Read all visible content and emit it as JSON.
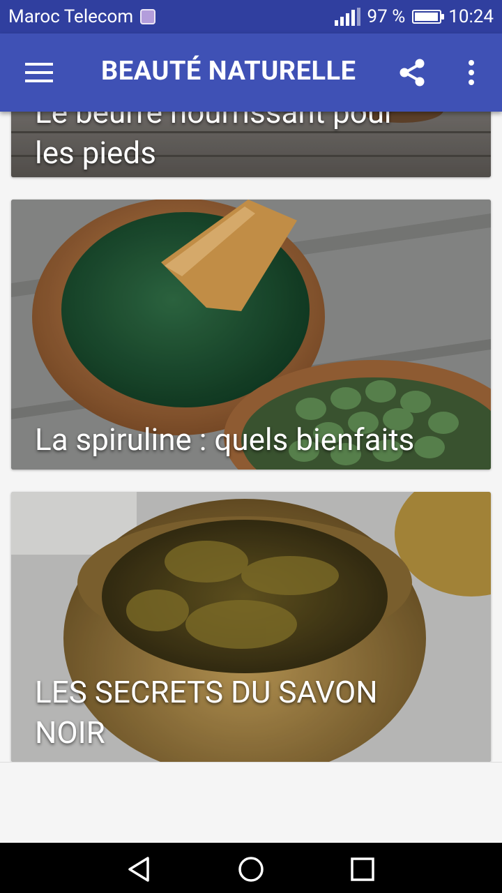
{
  "status_bar": {
    "carrier": "Maroc Telecom",
    "battery": "97 %",
    "battery_level": 0.97,
    "time": "10:24",
    "icons": [
      "notification-icon",
      "signal-icon",
      "battery-icon"
    ]
  },
  "app_bar": {
    "title": "BEAUTÉ NATURELLE",
    "icons": [
      "menu-icon",
      "share-icon",
      "more-vert-icon"
    ]
  },
  "articles": [
    {
      "title_line1": "Le beurre nourrissant pour",
      "title_line2": "les pieds"
    },
    {
      "title": "La spiruline : quels bienfaits"
    },
    {
      "title_line1": "LES SECRETS DU SAVON",
      "title_line2": "NOIR"
    }
  ],
  "nav_bar": {
    "icons": [
      "back-icon",
      "home-icon",
      "recents-icon"
    ]
  }
}
